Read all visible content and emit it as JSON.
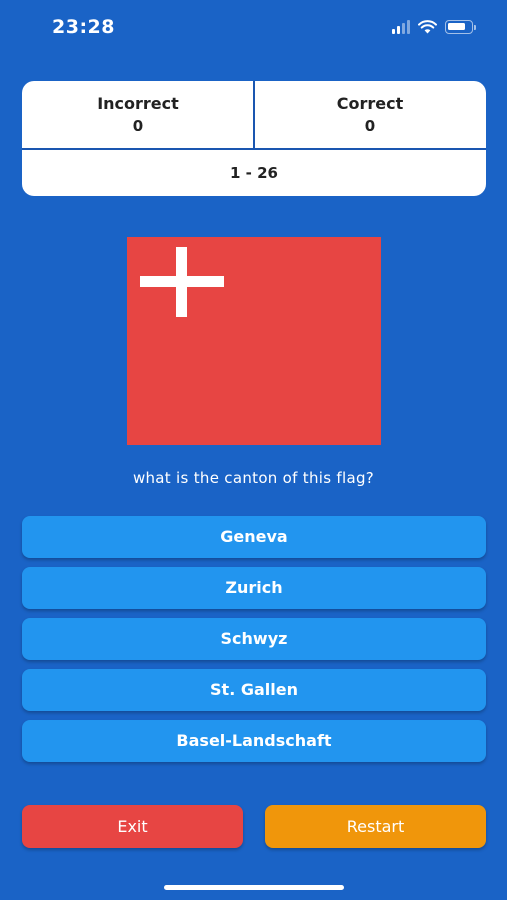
{
  "status_bar": {
    "time": "23:28",
    "icons": [
      "cellular-signal-icon",
      "wifi-icon",
      "battery-icon"
    ]
  },
  "score": {
    "incorrect_label": "Incorrect",
    "incorrect_value": "0",
    "correct_label": "Correct",
    "correct_value": "0",
    "range": "1 - 26"
  },
  "question": {
    "text": "what is the canton of this flag?"
  },
  "answers": [
    {
      "label": "Geneva"
    },
    {
      "label": "Zurich"
    },
    {
      "label": "Schwyz"
    },
    {
      "label": "St. Gallen"
    },
    {
      "label": "Basel-Landschaft"
    }
  ],
  "actions": {
    "exit_label": "Exit",
    "restart_label": "Restart"
  },
  "colors": {
    "background": "#1a63c6",
    "answer_button": "#2295ef",
    "exit_button": "#e74543",
    "restart_button": "#f0960b",
    "flag_red": "#e74543",
    "flag_cross": "#ffffff"
  }
}
